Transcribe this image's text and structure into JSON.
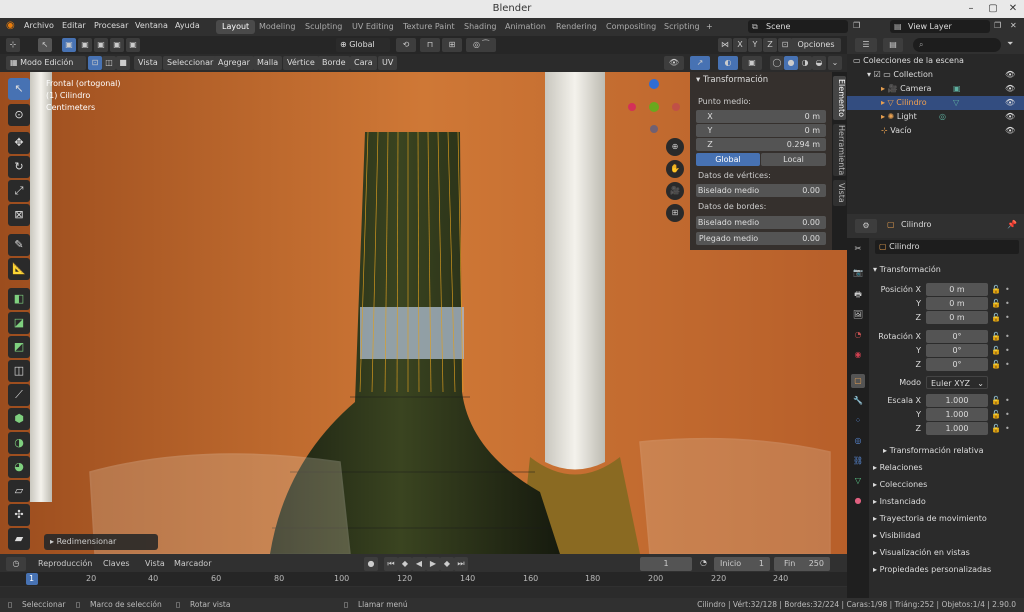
{
  "window": {
    "title": "Blender"
  },
  "menubar": {
    "items": [
      "Archivo",
      "Editar",
      "Procesar",
      "Ventana",
      "Ayuda"
    ]
  },
  "workspaces": [
    "Layout",
    "Modeling",
    "Sculpting",
    "UV Editing",
    "Texture Paint",
    "Shading",
    "Animation",
    "Rendering",
    "Compositing",
    "Scripting"
  ],
  "scene": {
    "name": "Scene",
    "view_layer": "View Layer"
  },
  "viewport_header": {
    "orientation": "Global",
    "options_label": "Opciones",
    "mode": "Modo Edición",
    "menus": [
      "Vista",
      "Seleccionar",
      "Agregar",
      "Malla",
      "Vértice",
      "Borde",
      "Cara",
      "UV"
    ],
    "axes": [
      "X",
      "Y",
      "Z"
    ]
  },
  "viewport_info": {
    "line1": "Frontal (ortogonal)",
    "line2": "(1) Cilindro",
    "line3": "Centimeters"
  },
  "last_op": {
    "label": "Redimensionar"
  },
  "npanel": {
    "title": "Transformación",
    "midpoint_label": "Punto medio:",
    "x_label": "X",
    "x_value": "0 m",
    "y_label": "Y",
    "y_value": "0 m",
    "z_label": "Z",
    "z_value": "0.294 m",
    "global_label": "Global",
    "local_label": "Local",
    "vertex_data_label": "Datos de vértices:",
    "bevel_label": "Biselado medio",
    "bevel_vertex_value": "0.00",
    "edge_data_label": "Datos de bordes:",
    "bevel_edge_value": "0.00",
    "crease_label": "Plegado medio",
    "crease_value": "0.00",
    "tabs": [
      "Elemento",
      "Herramienta",
      "Vista"
    ]
  },
  "outliner": {
    "root": "Colecciones de la escena",
    "items": [
      "Collection",
      "Camera",
      "Cilindro",
      "Light",
      "Vacío"
    ]
  },
  "properties": {
    "object_name": "Cilindro",
    "data_name": "Cilindro",
    "transform_label": "Transformación",
    "pos_x_label": "Posición X",
    "pos_x": "0 m",
    "pos_y_label": "Y",
    "pos_y": "0 m",
    "pos_z_label": "Z",
    "pos_z": "0 m",
    "rot_x_label": "Rotación X",
    "rot_x": "0°",
    "rot_y_label": "Y",
    "rot_y": "0°",
    "rot_z_label": "Z",
    "rot_z": "0°",
    "mode_label": "Modo",
    "mode_value": "Euler XYZ",
    "scale_x_label": "Escala X",
    "scale_x": "1.000",
    "scale_y_label": "Y",
    "scale_y": "1.000",
    "scale_z_label": "Z",
    "scale_z": "1.000",
    "delta_label": "Transformación relativa",
    "sections": [
      "Relaciones",
      "Colecciones",
      "Instanciado",
      "Trayectoria de movimiento",
      "Visibilidad",
      "Visualización en vistas",
      "Propiedades personalizadas"
    ]
  },
  "timeline": {
    "menus": [
      "Reproducción",
      "Claves",
      "Vista",
      "Marcador"
    ],
    "current_frame": "1",
    "start_label": "Inicio",
    "start": "1",
    "end_label": "Fin",
    "end": "250",
    "ticks": [
      "1",
      "20",
      "40",
      "60",
      "80",
      "100",
      "120",
      "140",
      "160",
      "180",
      "200",
      "220",
      "240"
    ]
  },
  "statusbar": {
    "select": "Seleccionar",
    "box": "Marco de selección",
    "rotate": "Rotar vista",
    "menu": "Llamar menú",
    "stats": "Cilindro | Vért:32/128 | Bordes:32/224 | Caras:1/98 | Triáng:252 | Objetos:1/4 | 2.90.0"
  },
  "colors": {
    "accent": "#4772b3",
    "backdrop": "#c46a2e"
  }
}
